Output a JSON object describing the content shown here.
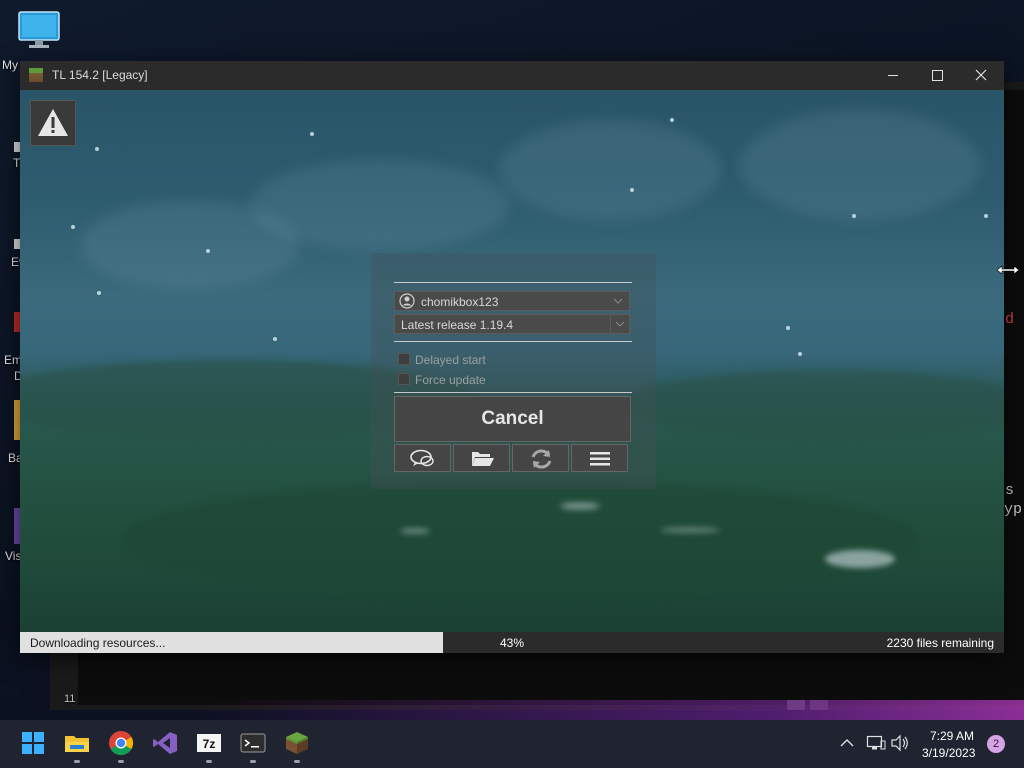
{
  "desktop": {
    "icons": [
      {
        "label": "My",
        "name": "this-pc"
      },
      {
        "label": "T",
        "name": "item-2"
      },
      {
        "label": "Ev",
        "name": "item-3"
      },
      {
        "label": "Em",
        "name": "item-4"
      },
      {
        "label": "D",
        "name": "item-4b"
      },
      {
        "label": "Ba",
        "name": "item-5"
      },
      {
        "label": "Vis",
        "name": "item-6"
      }
    ],
    "bg_window": {
      "red_text": "d",
      "white_text_1": "s",
      "white_text_2": "yp",
      "footer_number": "11"
    }
  },
  "window": {
    "title": "TL 154.2 [Legacy]",
    "icon": "grass-block-icon",
    "controls": [
      "minimize-icon",
      "maximize-icon",
      "close-icon"
    ]
  },
  "launcher": {
    "account": "chomikbox123",
    "version": "Latest release 1.19.4",
    "options": [
      {
        "label": "Delayed start",
        "checked": false
      },
      {
        "label": "Force update",
        "checked": false
      }
    ],
    "cancel_label": "Cancel",
    "tools": [
      "chat-bubbles-icon",
      "folder-open-icon",
      "refresh-icon",
      "hamburger-menu-icon"
    ]
  },
  "status": {
    "text": "Downloading resources...",
    "progress_percent": 43,
    "percent_text": "43%",
    "remaining": "2230 files remaining"
  },
  "taskbar": {
    "apps": [
      "windows-start-icon",
      "file-explorer-icon",
      "chrome-icon",
      "visual-studio-icon",
      "7zip-icon",
      "terminal-icon",
      "minecraft-launcher-icon"
    ],
    "tray": [
      "chevron-up-icon",
      "network-icon",
      "volume-icon"
    ],
    "time": "7:29 AM",
    "date": "3/19/2023",
    "notification_count": "2"
  },
  "colors": {
    "accent": "#e1e1e1",
    "window_bg": "#2b2b2b",
    "taskbar_bg": "#1f2430"
  }
}
